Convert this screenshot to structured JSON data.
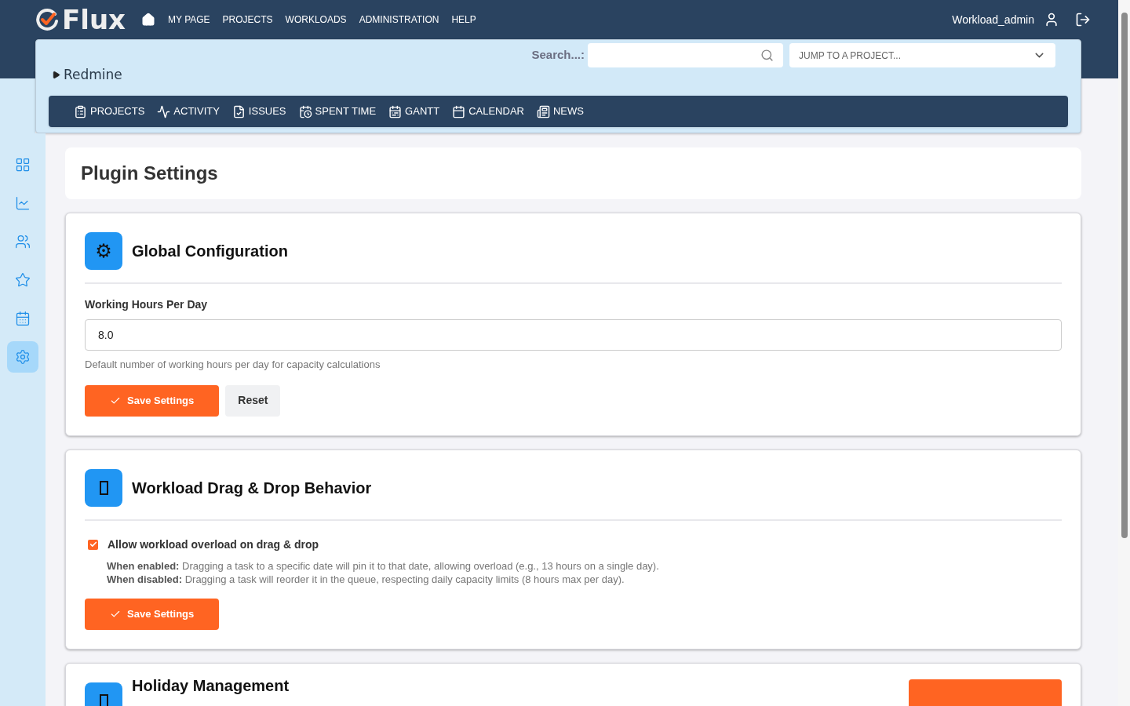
{
  "brand": {
    "name": "Flux"
  },
  "top_nav": [
    "MY PAGE",
    "PROJECTS",
    "WORKLOADS",
    "ADMINISTRATION",
    "HELP"
  ],
  "user": {
    "name": "Workload_admin"
  },
  "project": {
    "name": "Redmine",
    "expanded": false
  },
  "search": {
    "label": "Search...:"
  },
  "jump": {
    "placeholder": "JUMP TO A PROJECT..."
  },
  "project_menu": [
    {
      "kind": "projects",
      "label": "PROJECTS"
    },
    {
      "kind": "activity",
      "label": "ACTIVITY"
    },
    {
      "kind": "issues",
      "label": "ISSUES"
    },
    {
      "kind": "time",
      "label": "SPENT TIME"
    },
    {
      "kind": "gantt",
      "label": "GANTT"
    },
    {
      "kind": "calendar",
      "label": "CALENDAR"
    },
    {
      "kind": "news",
      "label": "NEWS"
    }
  ],
  "sidebar": [
    {
      "kind": "grid",
      "selected": false
    },
    {
      "kind": "chart",
      "selected": false
    },
    {
      "kind": "users",
      "selected": false
    },
    {
      "kind": "star",
      "selected": false
    },
    {
      "kind": "calendar",
      "selected": false
    },
    {
      "kind": "settings",
      "selected": true
    }
  ],
  "page_title": "Plugin Settings",
  "sections": [
    {
      "kind": "form",
      "icon": "⚙",
      "title": "Global Configuration",
      "field_label": "Working Hours Per Day",
      "field_value": "8.0",
      "help": "Default number of working hours per day for capacity calculations",
      "buttons": [
        {
          "kind": "primary",
          "label": "Save Settings"
        },
        {
          "kind": "secondary",
          "label": "Reset"
        }
      ]
    },
    {
      "kind": "checkbox",
      "title": "Workload Drag & Drop Behavior",
      "checkbox_label": "Allow workload overload on drag & drop",
      "checked": true,
      "notes": [
        "**When enabled:** Dragging a task to a specific date will pin it to that date, allowing overload (e.g., 13 hours on a single day).",
        "**When disabled:** Dragging a task will reorder it in the queue, respecting daily capacity limits (8 hours max per day)."
      ],
      "buttons": [
        {
          "kind": "primary",
          "label": "Save Settings"
        }
      ]
    },
    {
      "kind": "header_action",
      "title": "Holiday Management"
    }
  ]
}
